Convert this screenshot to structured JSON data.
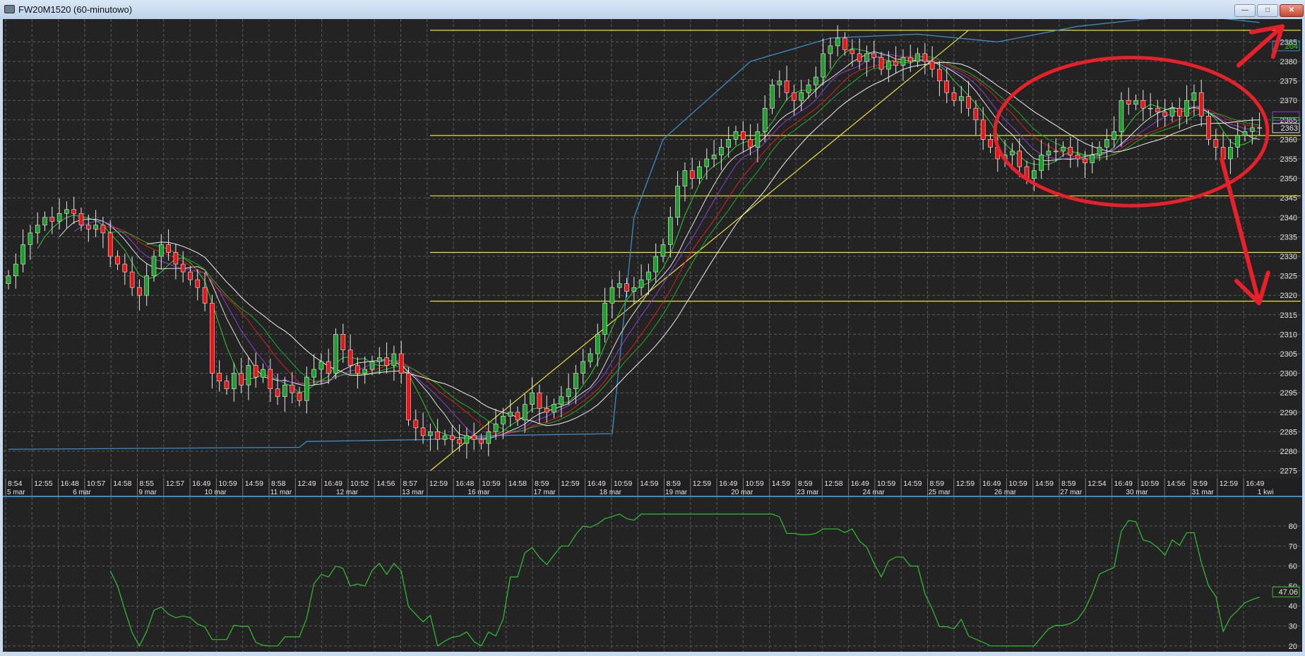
{
  "window": {
    "title": "FW20M1520 (60-minutowo)",
    "minimize_label": "—",
    "maximize_label": "□",
    "close_label": "✕"
  },
  "colors": {
    "background": "#232323",
    "grid": "#5a5a5a",
    "bull": "#1e9e2a",
    "bear": "#e01818",
    "level": "#e8e23a",
    "envelope": "#3b8ec4",
    "rsi": "#2fc12f",
    "annotation": "#e8202a"
  },
  "chart_data": [
    {
      "type": "candlestick",
      "title": "",
      "price_ticks": [
        2275,
        2280,
        2285,
        2290,
        2295,
        2300,
        2305,
        2310,
        2315,
        2320,
        2325,
        2330,
        2335,
        2340,
        2345,
        2350,
        2355,
        2360,
        2365,
        2370,
        2375,
        2380,
        2385
      ],
      "ylim": [
        2274,
        2392
      ],
      "grid": true,
      "time_labels": [
        "8:54",
        "12:55",
        "16:48",
        "10:57",
        "14:58",
        "8:55",
        "12:57",
        "16:49",
        "10:59",
        "14:59",
        "8:58",
        "12:49",
        "16:49",
        "10:52",
        "14:56",
        "8:57",
        "12:59",
        "16:48",
        "10:59",
        "14:58",
        "8:59",
        "12:59",
        "16:49",
        "10:59",
        "14:59",
        "8:59",
        "12:59",
        "16:49",
        "10:59",
        "14:59",
        "8:59",
        "12:58",
        "16:49",
        "10:59",
        "14:59",
        "8:59",
        "12:59",
        "16:49",
        "10:59",
        "14:59",
        "8:59",
        "12:54",
        "16:49",
        "10:59",
        "14:56",
        "8:59",
        "12:59",
        "16:49"
      ],
      "date_labels": [
        "5 mar",
        "6 mar",
        "9 mar",
        "10 mar",
        "11 mar",
        "12 mar",
        "13 mar",
        "16 mar",
        "17 mar",
        "18 mar",
        "19 mar",
        "20 mar",
        "23 mar",
        "24 mar",
        "25 mar",
        "26 mar",
        "27 mar",
        "30 mar",
        "31 mar",
        "1 kwi"
      ],
      "close": [
        2325,
        2328,
        2333,
        2336,
        2338,
        2340,
        2339,
        2341,
        2342,
        2341,
        2338,
        2337,
        2338,
        2336,
        2330,
        2328,
        2326,
        2322,
        2320,
        2325,
        2330,
        2333,
        2331,
        2328,
        2326,
        2324,
        2322,
        2318,
        2300,
        2298,
        2296,
        2300,
        2297,
        2302,
        2299,
        2301,
        2296,
        2294,
        2297,
        2295,
        2293,
        2299,
        2301,
        2303,
        2300,
        2310,
        2306,
        2302,
        2300,
        2301,
        2303,
        2304,
        2302,
        2305,
        2300,
        2288,
        2286,
        2284,
        2285,
        2283,
        2284,
        2283,
        2282,
        2284,
        2283,
        2282,
        2285,
        2287,
        2289,
        2290,
        2288,
        2292,
        2295,
        2291,
        2290,
        2292,
        2294,
        2296,
        2300,
        2303,
        2305,
        2310,
        2318,
        2322,
        2323,
        2321,
        2322,
        2324,
        2326,
        2330,
        2333,
        2340,
        2348,
        2352,
        2350,
        2353,
        2355,
        2356,
        2358,
        2360,
        2362,
        2360,
        2358,
        2362,
        2368,
        2374,
        2375,
        2372,
        2370,
        2372,
        2374,
        2376,
        2382,
        2384,
        2386,
        2383,
        2382,
        2380,
        2382,
        2381,
        2378,
        2380,
        2379,
        2381,
        2380,
        2382,
        2380,
        2378,
        2375,
        2372,
        2370,
        2371,
        2368,
        2365,
        2360,
        2358,
        2355,
        2356,
        2357,
        2353,
        2350,
        2352,
        2356,
        2357,
        2357,
        2358,
        2356,
        2355,
        2354,
        2356,
        2358,
        2360,
        2362,
        2370,
        2369,
        2370,
        2368,
        2368,
        2367,
        2366,
        2368,
        2366,
        2370,
        2372,
        2366,
        2360,
        2358,
        2355,
        2358,
        2361,
        2362,
        2363,
        2363
      ],
      "moving_average_periods": [
        5,
        8,
        10,
        13,
        15,
        20
      ],
      "moving_average_colors": [
        "#33cc33",
        "#e0e0e0",
        "#8a3fd6",
        "#d82020",
        "#22aa22",
        "#f0f0f0"
      ],
      "envelope_line": [
        [
          0,
          2280.5
        ],
        [
          40,
          2281
        ],
        [
          41,
          2282.5
        ],
        [
          58,
          2283
        ],
        [
          66,
          2284
        ],
        [
          83,
          2284.5
        ],
        [
          86,
          2340
        ],
        [
          90,
          2360
        ],
        [
          96,
          2370
        ],
        [
          102,
          2380
        ],
        [
          113,
          2386
        ],
        [
          125,
          2387
        ],
        [
          136,
          2385
        ],
        [
          147,
          2389
        ],
        [
          162,
          2392
        ],
        [
          172,
          2390
        ]
      ],
      "horizontal_levels": [
        2388,
        2361,
        2345.5,
        2331,
        2318.5
      ],
      "trendline": [
        [
          58,
          2275
        ],
        [
          132,
          2388
        ]
      ],
      "price_boxes": {
        "envelope": "204",
        "last": "2363"
      }
    },
    {
      "type": "line",
      "title": "",
      "yticks": [
        20,
        30,
        40,
        50,
        60,
        70,
        80
      ],
      "ylim": [
        18,
        86
      ],
      "rsi_period": 14,
      "last_value_label": "47.06"
    }
  ],
  "annotations": {
    "ellipse": "highlight",
    "arrows": [
      "up",
      "down"
    ]
  }
}
